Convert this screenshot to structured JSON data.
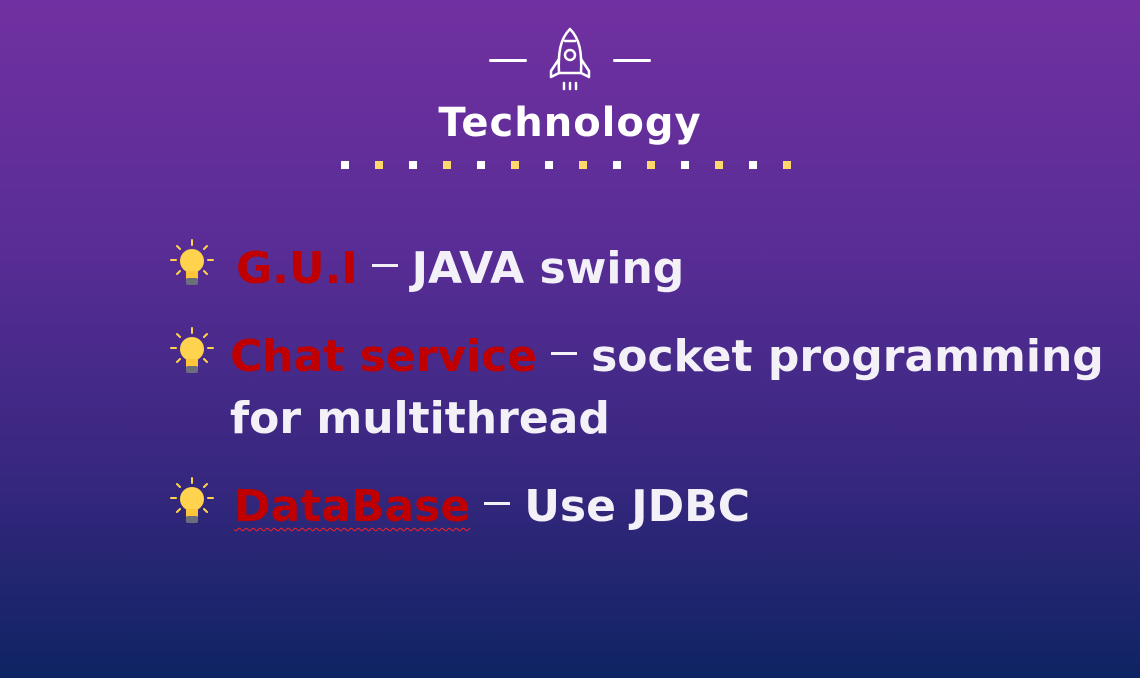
{
  "header": {
    "icon": "rocket-icon",
    "title": "Technology"
  },
  "colors": {
    "keyword": "#c00000",
    "text": "#f3f0f8",
    "dot_white": "#ffffff",
    "dot_yellow": "#ffd86b"
  },
  "items": [
    {
      "icon": "lightbulb-icon",
      "keyword": "G.U.I",
      "rest": "JAVA swing"
    },
    {
      "icon": "lightbulb-icon",
      "keyword": "Chat service",
      "rest": "socket programming",
      "rest2": "for multithread"
    },
    {
      "icon": "lightbulb-icon",
      "keyword": "DataBase",
      "rest": "Use JDBC"
    }
  ]
}
